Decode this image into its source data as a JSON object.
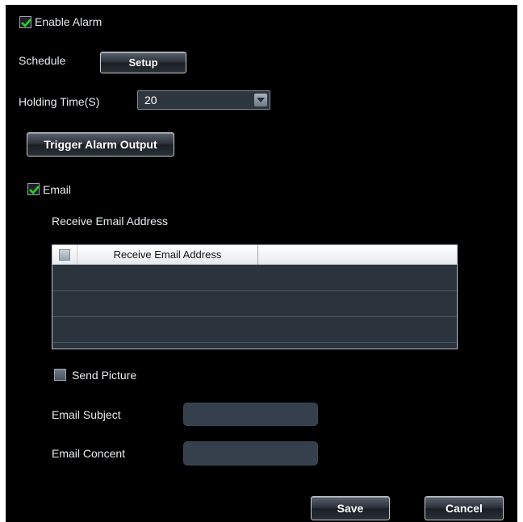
{
  "enable_alarm": {
    "label": "Enable Alarm",
    "checked": true
  },
  "schedule": {
    "label": "Schedule",
    "button": "Setup"
  },
  "holding_time": {
    "label": "Holding Time(S)",
    "value": "20"
  },
  "trigger_button": "Trigger Alarm Output",
  "email": {
    "label": "Email",
    "checked": true
  },
  "receive": {
    "section_label": "Receive Email Address",
    "table": {
      "column_header": "Receive Email Address",
      "rows": []
    }
  },
  "send_picture": {
    "label": "Send Picture",
    "checked": false
  },
  "email_subject": {
    "label": "Email Subject",
    "value": ""
  },
  "email_content": {
    "label": "Email Concent",
    "value": ""
  },
  "actions": {
    "save": "Save",
    "cancel": "Cancel"
  },
  "colors": {
    "check": "#27d427",
    "background": "#000000",
    "field": "#35404c"
  }
}
